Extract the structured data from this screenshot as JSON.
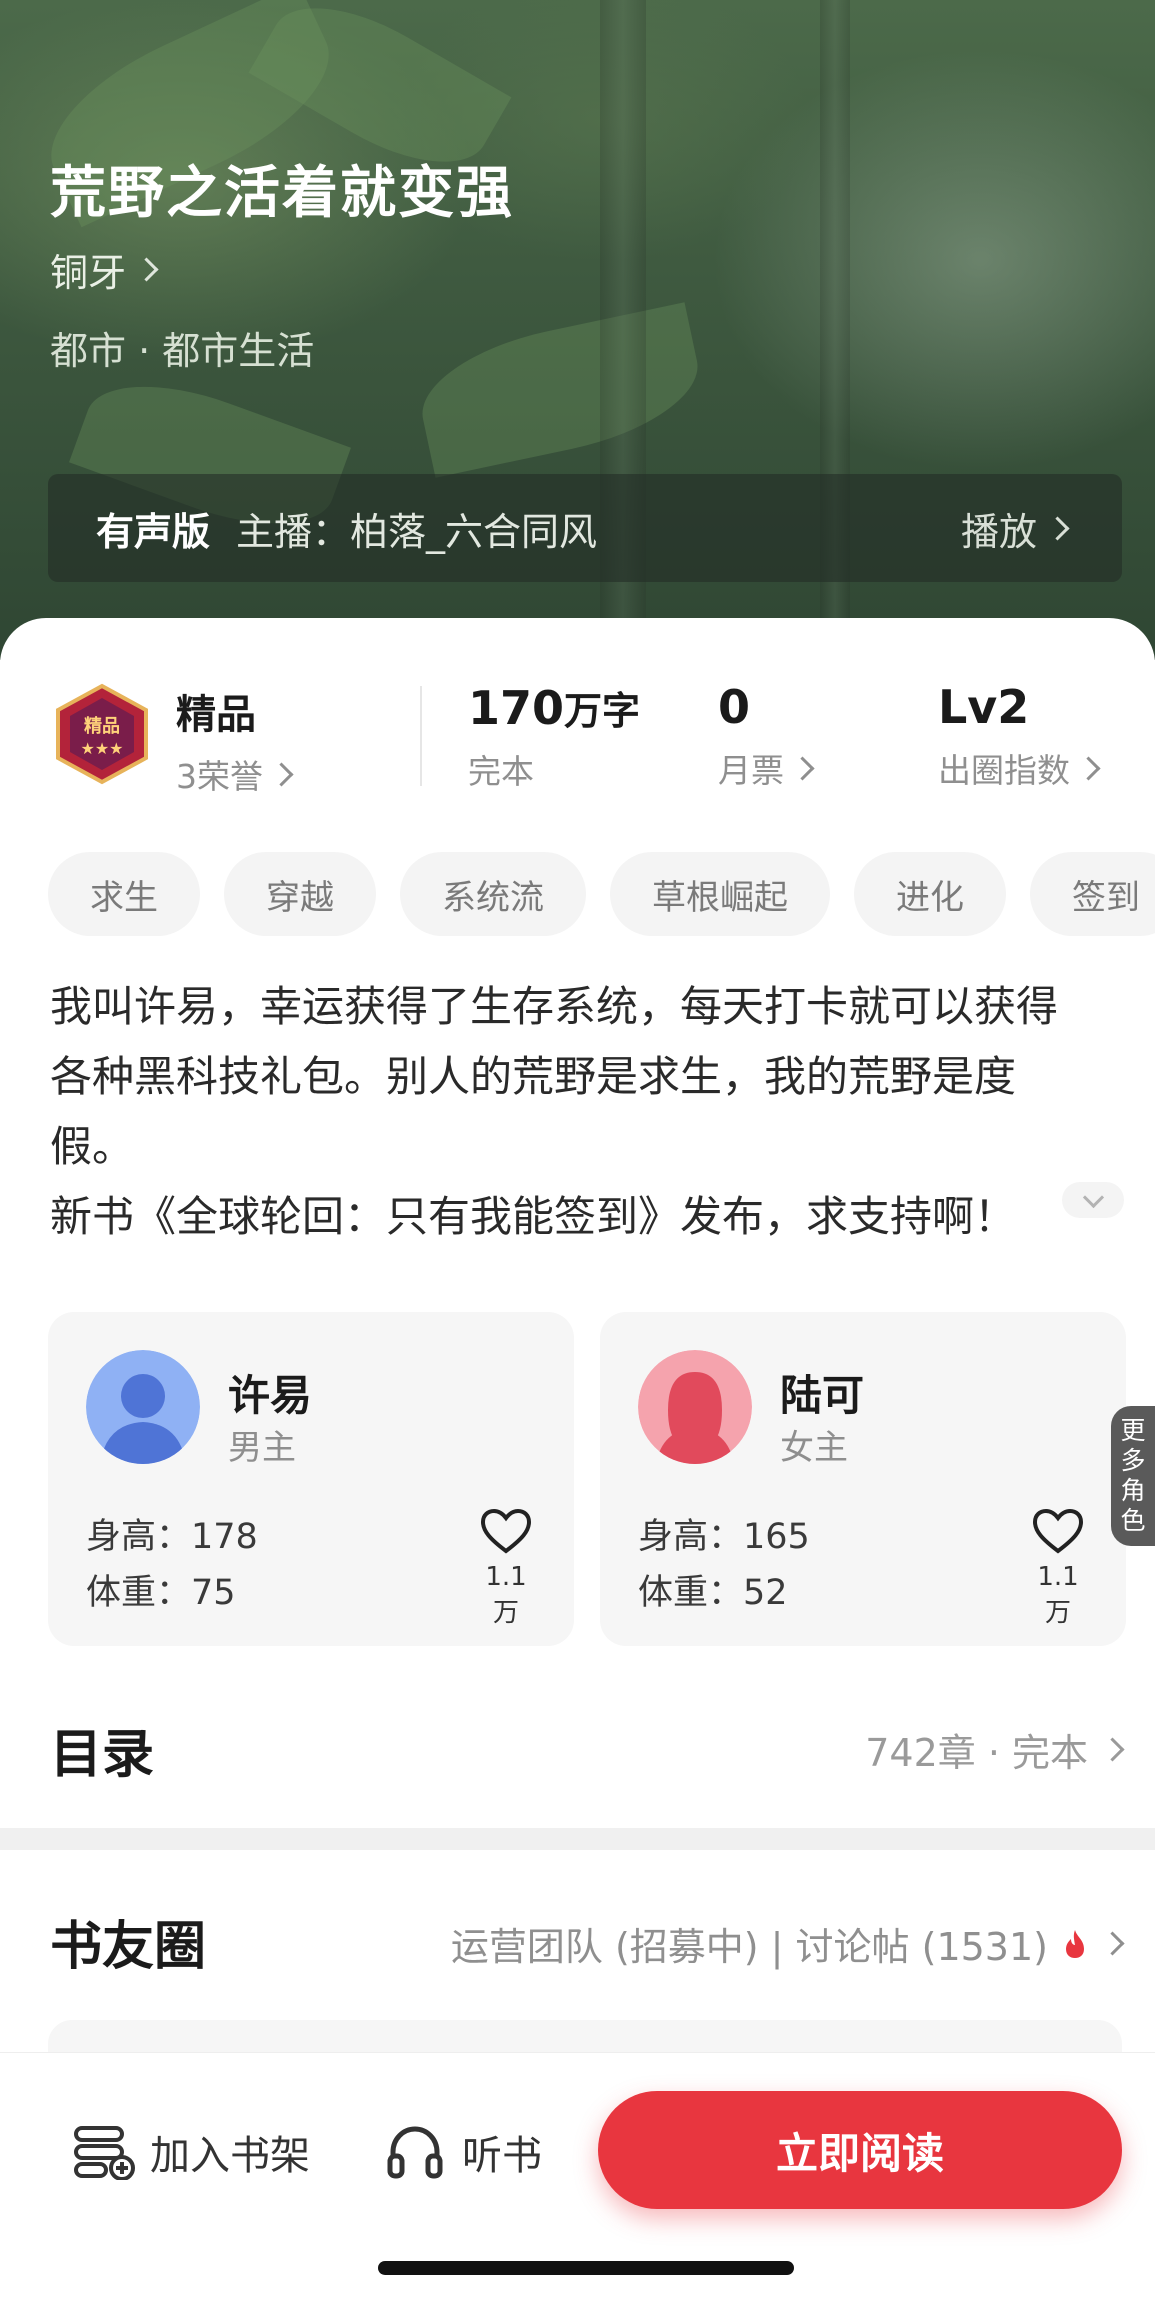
{
  "book": {
    "title": "荒野之活着就变强",
    "author": "铜牙",
    "genre": "都市 · 都市生活"
  },
  "audio": {
    "tag": "有声版",
    "anchor": "主播：柏落_六合同风",
    "play_label": "播放"
  },
  "stats": {
    "badge_label": "精品",
    "badge_icon": "premium-badge-icon",
    "honors": "3荣誉",
    "words_value": "170",
    "words_unit": "万字",
    "status": "完本",
    "tickets_value": "0",
    "tickets_label": "月票",
    "level_value": "Lv2",
    "level_label": "出圈指数"
  },
  "tags": [
    "求生",
    "穿越",
    "系统流",
    "草根崛起",
    "进化",
    "签到"
  ],
  "description": {
    "line1": "我叫许易，幸运获得了生存系统，每天打卡就可以获得",
    "line2": "各种黑科技礼包。别人的荒野是求生，我的荒野是度",
    "line3": "假。",
    "line4": "新书《全球轮回：只有我能签到》发布，求支持啊！"
  },
  "roles": [
    {
      "name": "许易",
      "type": "男主",
      "height": "身高：178",
      "weight": "体重：75",
      "likes": "1.1万"
    },
    {
      "name": "陆可",
      "type": "女主",
      "height": "身高：165",
      "weight": "体重：52",
      "likes": "1.1万"
    }
  ],
  "more_roles": [
    "更",
    "多",
    "角",
    "色"
  ],
  "toc": {
    "title": "目录",
    "info": "742章 · 完本"
  },
  "circle": {
    "title": "书友圈",
    "info": "运营团队 (招募中) | 讨论帖 (1531)"
  },
  "bottom_bar": {
    "shelf_label": "加入书架",
    "listen_label": "听书",
    "read_label": "立即阅读"
  },
  "colors": {
    "accent": "#e8363f",
    "male_avatar": "#8fb1f4",
    "female_avatar": "#f08a98"
  }
}
